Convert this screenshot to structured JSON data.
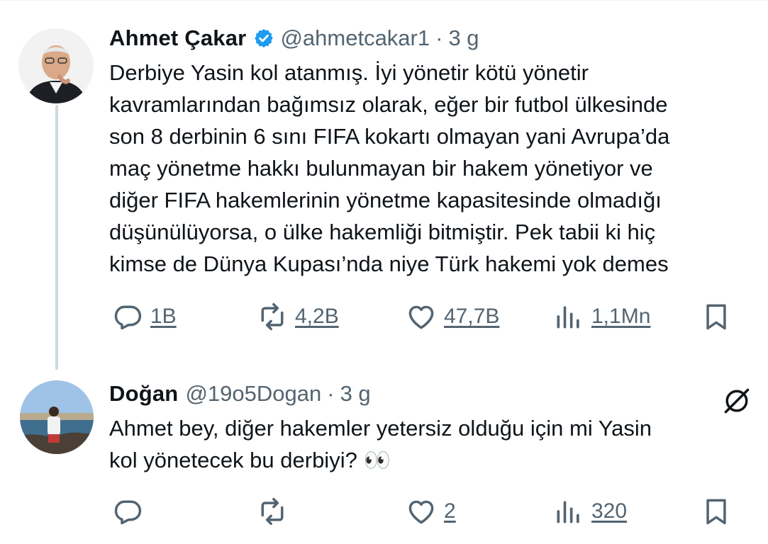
{
  "tweets": [
    {
      "name": "Ahmet Çakar",
      "handle": "@ahmetcakar1",
      "separator": "·",
      "time": "3 g",
      "verified": true,
      "text_lines": [
        "Derbiye Yasin kol atanmış. İyi yönetir kötü yönetir",
        "kavramlarından bağımsız olarak, eğer bir futbol ülkesinde",
        "son 8 derbinin 6 sını FIFA kokartı olmayan yani Avrupa’da",
        "maç yönetme hakkı bulunmayan bir hakem yönetiyor ve",
        "diğer FIFA hakemlerinin yönetme kapasitesinde olmadığı",
        "düşünülüyorsa, o ülke hakemliği bitmiştir. Pek tabii ki hiç",
        "kimse de Dünya Kupası’nda niye Türk hakemi yok demes"
      ],
      "stats": {
        "replies": "1B",
        "reposts": "4,2B",
        "likes": "47,7B",
        "views": "1,1Mn"
      }
    },
    {
      "name": "Doğan",
      "handle": "@19o5Dogan",
      "separator": "·",
      "time": "3 g",
      "verified": false,
      "text_lines": [
        "Ahmet bey, diğer hakemler yetersiz olduğu için mi Yasin",
        "kol yönetecek bu derbiyi? 👀"
      ],
      "stats": {
        "replies": "",
        "reposts": "",
        "likes": "2",
        "views": "320"
      }
    }
  ],
  "icons": {
    "reply": "reply-icon",
    "repost": "repost-icon",
    "like": "like-icon",
    "views": "views-icon",
    "bookmark": "bookmark-icon",
    "verified": "verified-badge-icon",
    "grok": "grok-icon"
  },
  "colors": {
    "text": "#0f1419",
    "muted": "#536471",
    "verified": "#1d9bf0",
    "thread_line": "#cfd9de"
  }
}
